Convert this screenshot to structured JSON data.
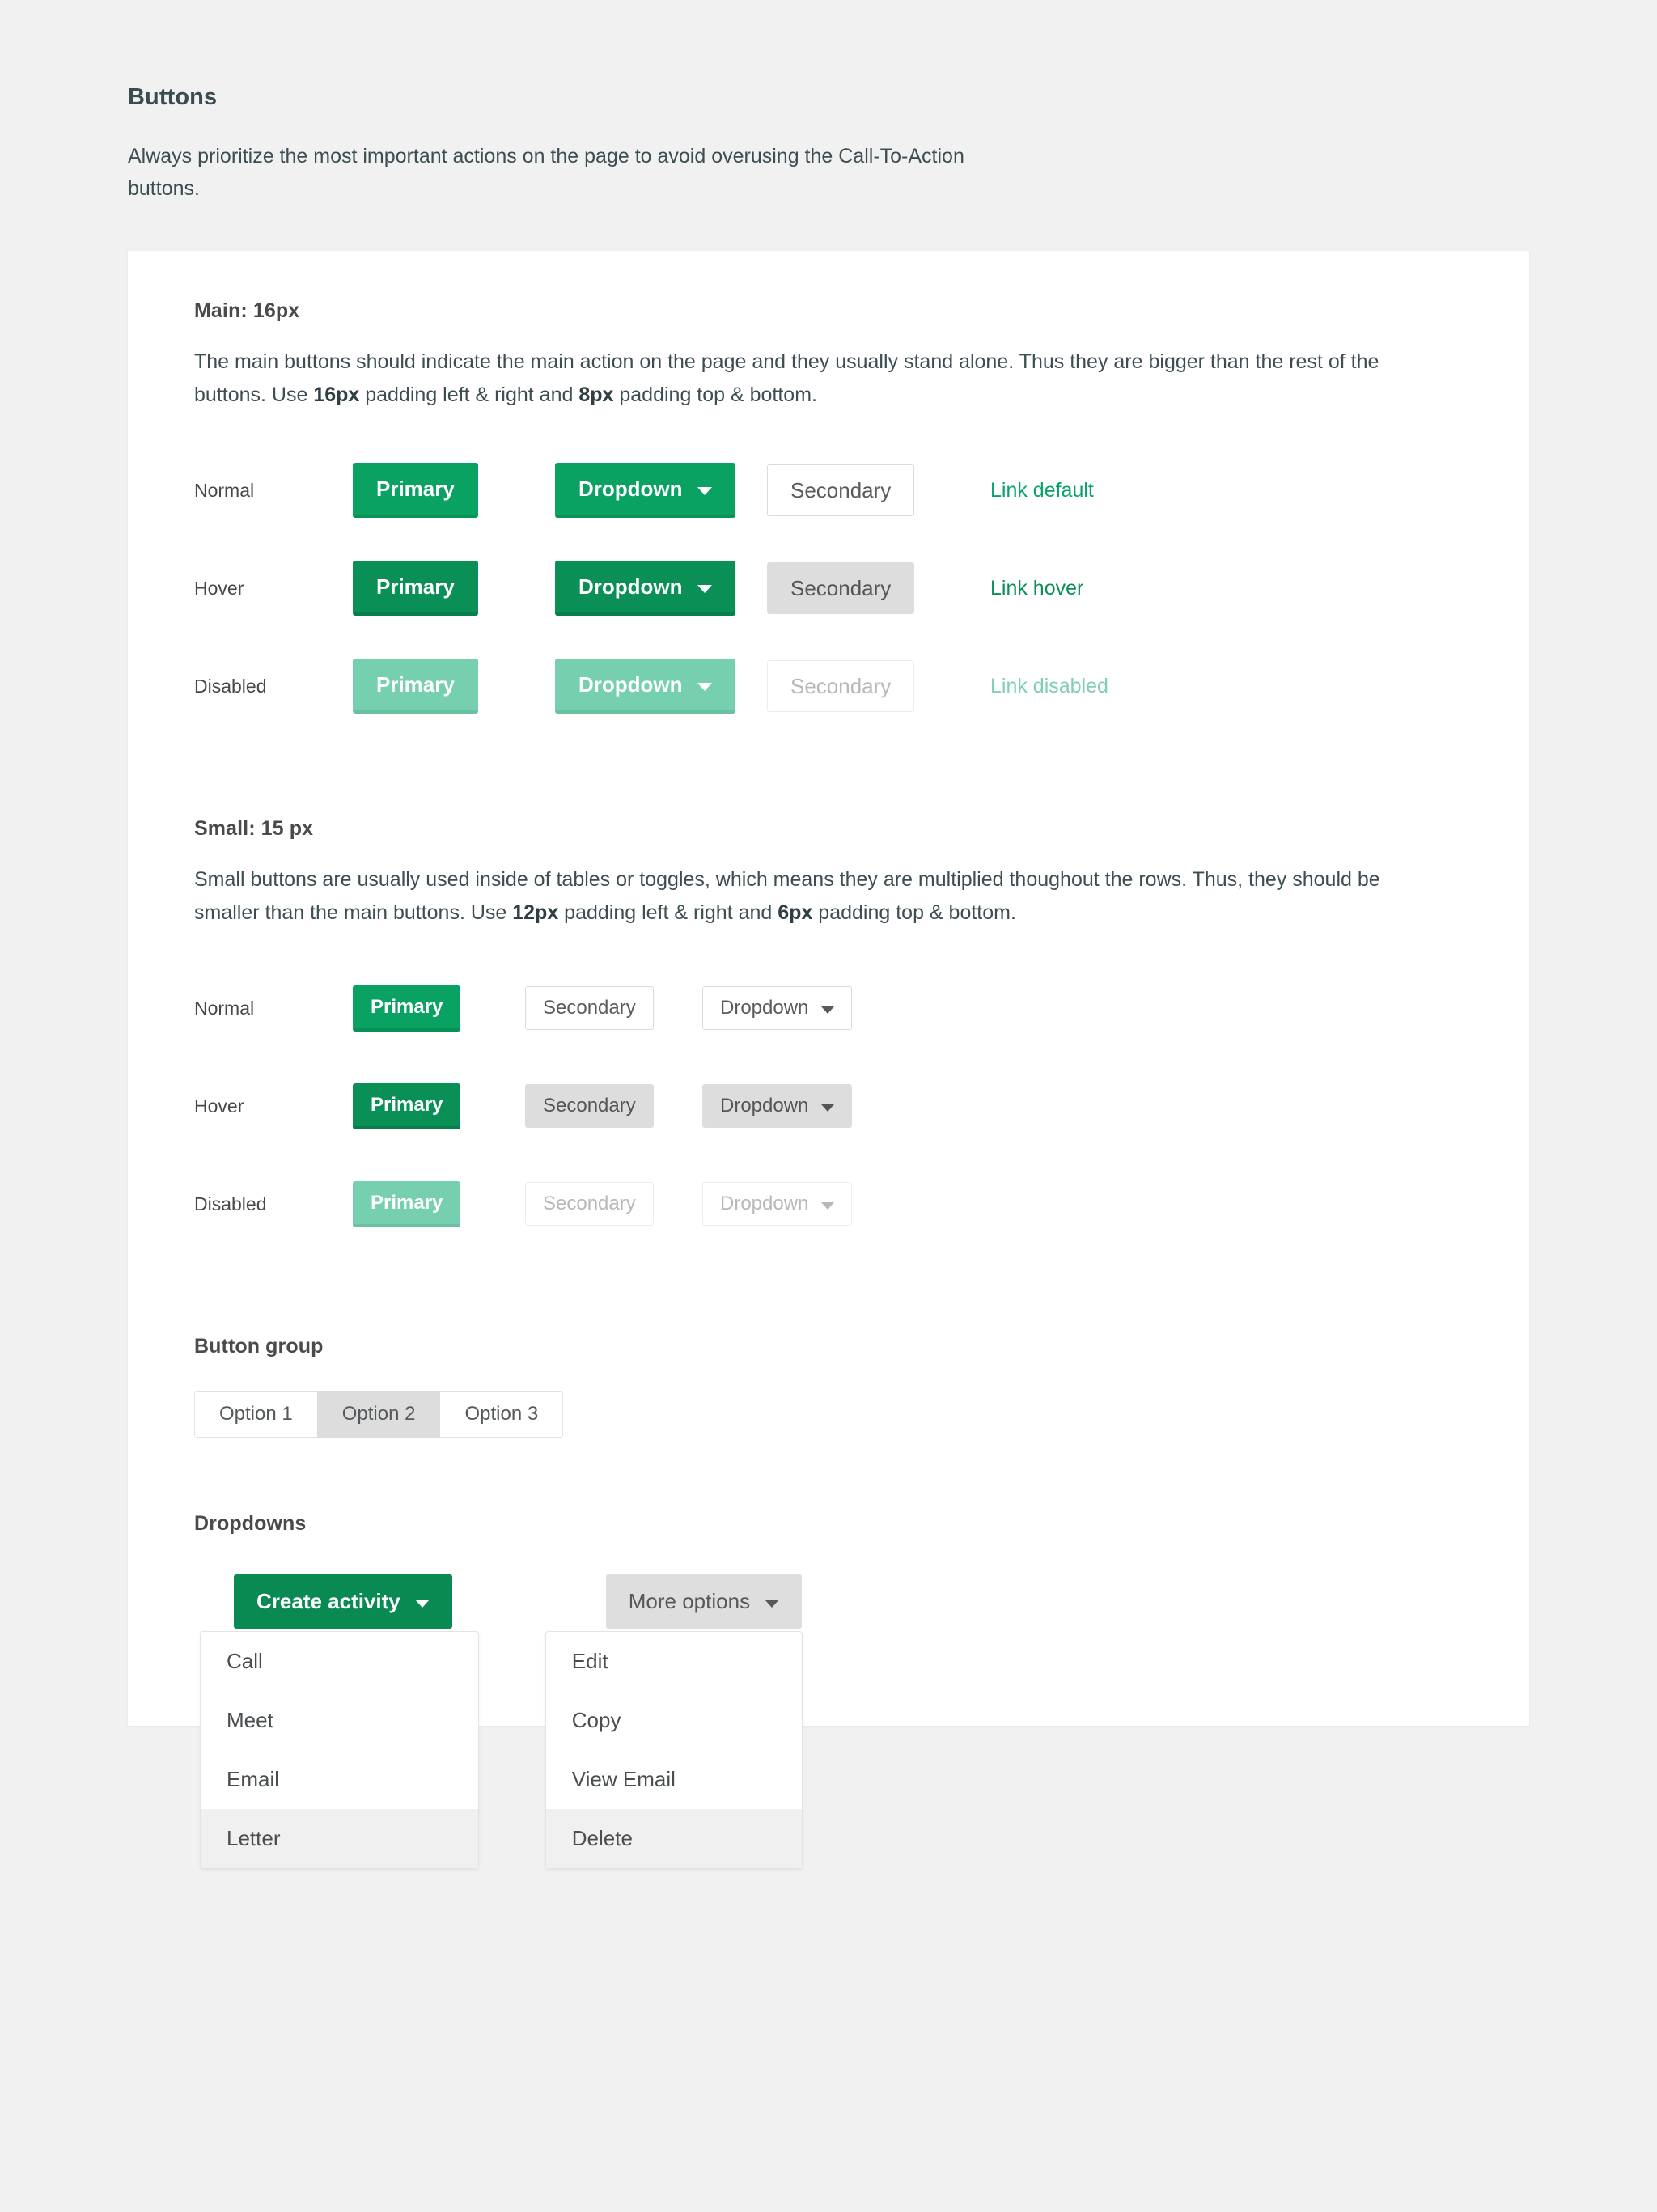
{
  "intro": {
    "title": "Buttons",
    "description": "Always prioritize the most important actions on the page to avoid overusing the Call-To-Action buttons."
  },
  "colors": {
    "primary": "#0aa263",
    "primary_hover": "#0a8f57",
    "primary_disabled": "#76cfae",
    "secondary_hover_bg": "#dddddd",
    "link": "#0aa16a",
    "link_hover": "#0a8f57",
    "link_disabled": "#7fcfb0",
    "page_bg": "#f1f1f1",
    "card_bg": "#ffffff",
    "menu_highlight": "#f0f0f0"
  },
  "main_section": {
    "title": "Main: 16px",
    "description": "The main buttons should indicate the main action on the page and they usually stand alone. Thus they are bigger than the rest of the buttons. Use 16px padding left & right and 8px padding top & bottom.",
    "description_parts": {
      "before": "The main buttons should indicate the main action on the page and they usually stand alone. Thus they are bigger than the rest of the buttons. Use ",
      "bold1": "16px",
      "middle": " padding left & right and ",
      "bold2": "8px",
      "after": " padding top & bottom."
    },
    "rows": [
      {
        "label": "Normal",
        "primary": "Primary",
        "dropdown": "Dropdown",
        "secondary": "Secondary",
        "link": "Link default"
      },
      {
        "label": "Hover",
        "primary": "Primary",
        "dropdown": "Dropdown",
        "secondary": "Secondary",
        "link": "Link hover"
      },
      {
        "label": "Disabled",
        "primary": "Primary",
        "dropdown": "Dropdown",
        "secondary": "Secondary",
        "link": "Link disabled"
      }
    ]
  },
  "small_section": {
    "title": "Small: 15 px",
    "description": "Small buttons are usually used inside of tables or toggles, which means they are multiplied thoughout the rows. Thus, they should be smaller than the main buttons. Use 12px padding left & right and 6px padding top & bottom.",
    "description_parts": {
      "before": "Small buttons are usually used inside of tables or toggles, which means they are multiplied thoughout the rows. Thus, they should be smaller than the main buttons. Use ",
      "bold1": "12px",
      "middle": " padding left & right and ",
      "bold2": "6px",
      "after": " padding top & bottom."
    },
    "rows": [
      {
        "label": "Normal",
        "primary": "Primary",
        "secondary": "Secondary",
        "dropdown": "Dropdown"
      },
      {
        "label": "Hover",
        "primary": "Primary",
        "secondary": "Secondary",
        "dropdown": "Dropdown"
      },
      {
        "label": "Disabled",
        "primary": "Primary",
        "secondary": "Secondary",
        "dropdown": "Dropdown"
      }
    ]
  },
  "button_group": {
    "title": "Button group",
    "options": [
      "Option 1",
      "Option 2",
      "Option 3"
    ],
    "selected_index": 1
  },
  "dropdowns": {
    "title": "Dropdowns",
    "create_activity": {
      "label": "Create activity",
      "items": [
        "Call",
        "Meet",
        "Email",
        "Letter"
      ],
      "active_index": 3
    },
    "more_options": {
      "label": "More options",
      "items": [
        "Edit",
        "Copy",
        "View Email",
        "Delete"
      ],
      "active_index": 3
    }
  }
}
